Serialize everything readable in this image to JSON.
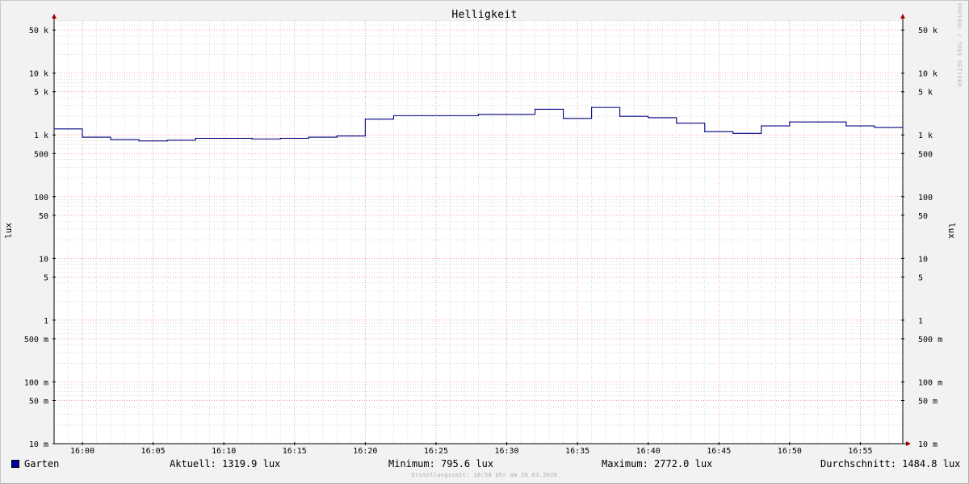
{
  "chart_data": {
    "type": "line",
    "title": "Helligkeit",
    "ylabel": "lux",
    "yscale": "log",
    "ylim": [
      0.01,
      70000
    ],
    "xlim": [
      "15:58",
      "17:58"
    ],
    "xlim_minutes": [
      958,
      1018
    ],
    "y_ticks": [
      {
        "value": 50000,
        "label": "50 k"
      },
      {
        "value": 10000,
        "label": "10 k"
      },
      {
        "value": 5000,
        "label": "5 k"
      },
      {
        "value": 1000,
        "label": "1 k"
      },
      {
        "value": 500,
        "label": "500"
      },
      {
        "value": 100,
        "label": "100"
      },
      {
        "value": 50,
        "label": "50"
      },
      {
        "value": 10,
        "label": "10"
      },
      {
        "value": 5,
        "label": "5"
      },
      {
        "value": 1,
        "label": "1"
      },
      {
        "value": 0.5,
        "label": "500 m"
      },
      {
        "value": 0.1,
        "label": "100 m"
      },
      {
        "value": 0.05,
        "label": "50 m"
      },
      {
        "value": 0.01,
        "label": "10 m"
      }
    ],
    "x_ticks": [
      {
        "minute": 960,
        "label": "16:00"
      },
      {
        "minute": 965,
        "label": "16:05"
      },
      {
        "minute": 970,
        "label": "16:10"
      },
      {
        "minute": 975,
        "label": "16:15"
      },
      {
        "minute": 980,
        "label": "16:20"
      },
      {
        "minute": 985,
        "label": "16:25"
      },
      {
        "minute": 990,
        "label": "16:30"
      },
      {
        "minute": 995,
        "label": "16:35"
      },
      {
        "minute": 1000,
        "label": "16:40"
      },
      {
        "minute": 1005,
        "label": "16:45"
      },
      {
        "minute": 1010,
        "label": "16:50"
      },
      {
        "minute": 1015,
        "label": "16:55"
      }
    ],
    "series": [
      {
        "name": "Garten",
        "color": "#000080",
        "step": true,
        "x": [
          958,
          960,
          962,
          964,
          966,
          968,
          970,
          972,
          974,
          976,
          978,
          980,
          982,
          984,
          986,
          988,
          990,
          992,
          994,
          996,
          998,
          1000,
          1002,
          1004,
          1006,
          1008,
          1010,
          1012,
          1014,
          1016,
          1018
        ],
        "values": [
          1250,
          920,
          840,
          800,
          820,
          880,
          880,
          860,
          880,
          920,
          960,
          1800,
          2050,
          2050,
          2050,
          2150,
          2150,
          2600,
          1850,
          2780,
          2000,
          1900,
          1550,
          1130,
          1060,
          1400,
          1620,
          1620,
          1400,
          1320,
          1320
        ]
      }
    ]
  },
  "legend": {
    "series_name": "Garten",
    "current": "Aktuell: 1319.9 lux",
    "minimum": "Minimum: 795.6 lux",
    "maximum": "Maximum: 2772.0 lux",
    "average": "Durchschnitt: 1484.8 lux"
  },
  "watermark": "RRDTOOL / TOBI OETIKER",
  "footer": "Erstellungszeit: 16:58 Uhr am 26.03.2026",
  "colors": {
    "background": "#f2f2f2",
    "plot_background": "#ffffff",
    "major_grid": "#ff8080",
    "minor_grid": "#c0c0c0",
    "line": "#000080",
    "arrow": "#a00000"
  }
}
